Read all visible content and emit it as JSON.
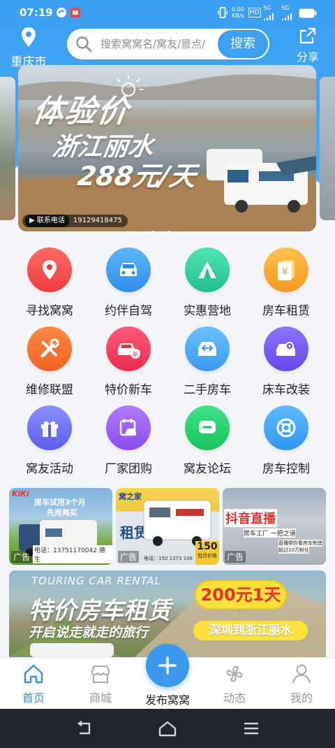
{
  "status_bar": {
    "time": "07:19",
    "net_speed": "0.00",
    "net_unit": "KB/s",
    "hd": "HD",
    "sig1": "5G",
    "sig2": "5G"
  },
  "header": {
    "city": "重庆市",
    "search_placeholder": "搜索窝窝名/窝友/景点/",
    "search_button": "搜索",
    "share_label": "分享"
  },
  "banner": {
    "line1": "体验价",
    "line2": "浙江丽水",
    "line3": "288元/天",
    "phone_label": "联系电话",
    "phone_number": "19129418475",
    "dots": 3,
    "active_dot": 3
  },
  "grid": {
    "items": [
      {
        "label": "寻找窝窝",
        "icon": "location-pin-icon",
        "color": "#f24b4b"
      },
      {
        "label": "约伴自驾",
        "icon": "car-icon",
        "color": "#3a9ef0"
      },
      {
        "label": "实惠营地",
        "icon": "tent-icon",
        "color": "#2fcf9d"
      },
      {
        "label": "房车租赁",
        "icon": "yen-card-icon",
        "color": "#f7a72a"
      },
      {
        "label": "维修联盟",
        "icon": "tools-icon",
        "color": "#f56c2b"
      },
      {
        "label": "特价新车",
        "icon": "new-car-icon",
        "color": "#ef3a5a"
      },
      {
        "label": "二手房车",
        "icon": "used-car-icon",
        "color": "#43a8f0"
      },
      {
        "label": "床车改装",
        "icon": "car-gear-icon",
        "color": "#7656f0"
      },
      {
        "label": "窝友活动",
        "icon": "gift-icon",
        "color": "#6d72f0"
      },
      {
        "label": "厂家团购",
        "icon": "calendar-car-icon",
        "color": "#9a5bf0"
      },
      {
        "label": "窝友论坛",
        "icon": "chat-icon",
        "color": "#27d06b"
      },
      {
        "label": "房车控制",
        "icon": "control-icon",
        "color": "#3da5f0"
      }
    ]
  },
  "ads": [
    {
      "tag": "广告",
      "title": "房车试用3个月",
      "subtitle": "先用再买",
      "brand": "KiKi",
      "phone": "电话：13751170042 德生"
    },
    {
      "tag": "广告",
      "text1": "窝之家",
      "text2": "租赁",
      "price": "150",
      "price_note": "包月价格",
      "phone": "电话：150 1373 108"
    },
    {
      "tag": "广告",
      "title": "抖音直播",
      "subtitle": "房车工厂 一把之道",
      "note": "直播带你看房车制造",
      "note2": "超过10万粉丝"
    }
  ],
  "promo": {
    "eng": "TOURING CAR RENTAL",
    "title": "特价房车租赁",
    "price": "200元1天",
    "subtitle": "开启说走就走的旅行",
    "route": "深圳到浙江丽水"
  },
  "tabbar": {
    "items": [
      {
        "label": "首页",
        "active": true
      },
      {
        "label": "商城",
        "active": false
      },
      {
        "label": "发布窝窝",
        "active": false
      },
      {
        "label": "动态",
        "active": false
      },
      {
        "label": "我的",
        "active": false
      }
    ]
  }
}
